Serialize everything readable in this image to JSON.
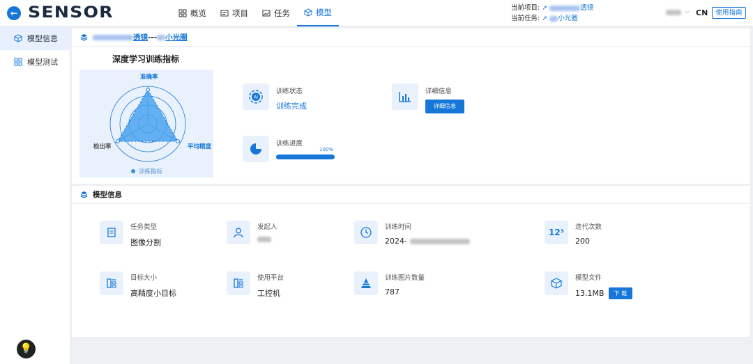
{
  "header": {
    "logo": "SENSOR",
    "nav": [
      {
        "label": "概览",
        "icon": "overview-icon",
        "active": false
      },
      {
        "label": "项目",
        "icon": "project-icon",
        "active": false
      },
      {
        "label": "任务",
        "icon": "task-icon",
        "active": false
      },
      {
        "label": "模型",
        "icon": "model-icon",
        "active": true
      }
    ],
    "current_project_label": "当前项目:",
    "current_project_suffix": "透镜",
    "current_task_label": "当前任务:",
    "current_task_suffix": "小光圈",
    "lang": "CN",
    "guide_button": "使用指南"
  },
  "sidebar": {
    "items": [
      {
        "label": "模型信息",
        "active": true
      },
      {
        "label": "模型测试",
        "active": false
      }
    ]
  },
  "breadcrumb": {
    "part1_suffix": "透镜",
    "separator": "---",
    "part2_suffix": "小光圈"
  },
  "training": {
    "radar_title": "深度学习训练指标",
    "axes": [
      "准确率",
      "平均精度",
      "检出率"
    ],
    "legend": "训练指标",
    "status_label": "训练状态",
    "status_value": "训练完成",
    "detail_label": "详细信息",
    "detail_button": "详细信息",
    "progress_label": "训练进度",
    "progress_value": 100,
    "progress_text": "100%"
  },
  "model_info": {
    "title": "模型信息",
    "task_type_label": "任务类型",
    "task_type_value": "图像分割",
    "initiator_label": "发起人",
    "train_time_label": "训练时间",
    "train_time_prefix": "2024-",
    "iterations_label": "迭代次数",
    "iterations_value": "200",
    "target_size_label": "目标大小",
    "target_size_value": "高精度小目标",
    "platform_label": "使用平台",
    "platform_value": "工控机",
    "image_count_label": "训练图片数量",
    "image_count_value": "787",
    "model_file_label": "模型文件",
    "model_file_value": "13.1MB",
    "download_button": "下 载"
  },
  "colors": {
    "accent": "#1677d9",
    "radar_fill": "#4aa3ef",
    "panel_bg": "#e9f1fc"
  }
}
